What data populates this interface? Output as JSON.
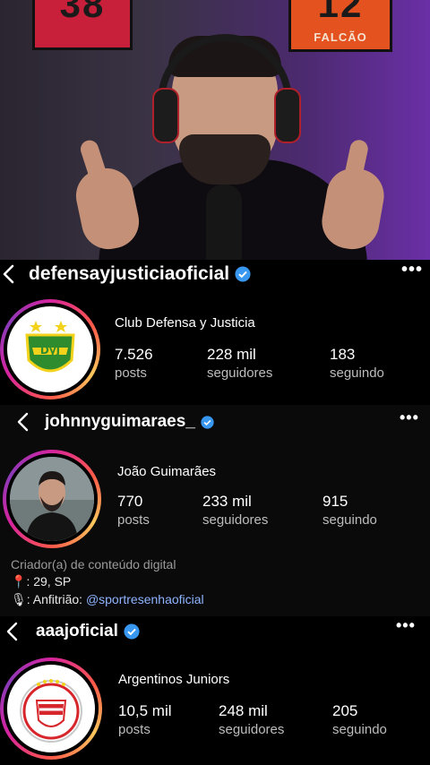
{
  "video": {
    "poster_left_number": "38",
    "poster_right_number": "12",
    "poster_right_name": "FALCÃO"
  },
  "profiles": [
    {
      "handle": "defensayjusticiaoficial",
      "verified": true,
      "full_name": "Club Defensa y Justicia",
      "logo_text": "DyJ",
      "stats": [
        {
          "value": "7.526",
          "label": "posts"
        },
        {
          "value": "228 mil",
          "label": "seguidores"
        },
        {
          "value": "183",
          "label": "seguindo"
        }
      ]
    },
    {
      "handle": "johnnyguimaraes_",
      "verified": true,
      "full_name": "João Guimarães",
      "stats": [
        {
          "value": "770",
          "label": "posts"
        },
        {
          "value": "233 mil",
          "label": "seguidores"
        },
        {
          "value": "915",
          "label": "seguindo"
        }
      ],
      "bio": {
        "category": "Criador(a) de conteúdo digital",
        "line1_icon": "📍",
        "line1": ": 29, SP",
        "line2_icon": "🎙",
        "line2_prefix": ": Anfitrião: ",
        "line2_link": "@sportresenhaoficial"
      }
    },
    {
      "handle": "aaajoficial",
      "verified": true,
      "full_name": "Argentinos Juniors",
      "stats": [
        {
          "value": "10,5 mil",
          "label": "posts"
        },
        {
          "value": "248 mil",
          "label": "seguidores"
        },
        {
          "value": "205",
          "label": "seguindo"
        }
      ]
    }
  ],
  "colors": {
    "verified": "#3897f0",
    "link": "#8fb4ff",
    "dyj_green": "#2e8b2e",
    "dyj_yellow": "#f2d21b",
    "aaaj_red": "#d7262b"
  },
  "icons": [
    "back-chevron-icon",
    "verified-badge-icon",
    "more-options-icon",
    "location-pin-icon",
    "microphone-icon"
  ]
}
